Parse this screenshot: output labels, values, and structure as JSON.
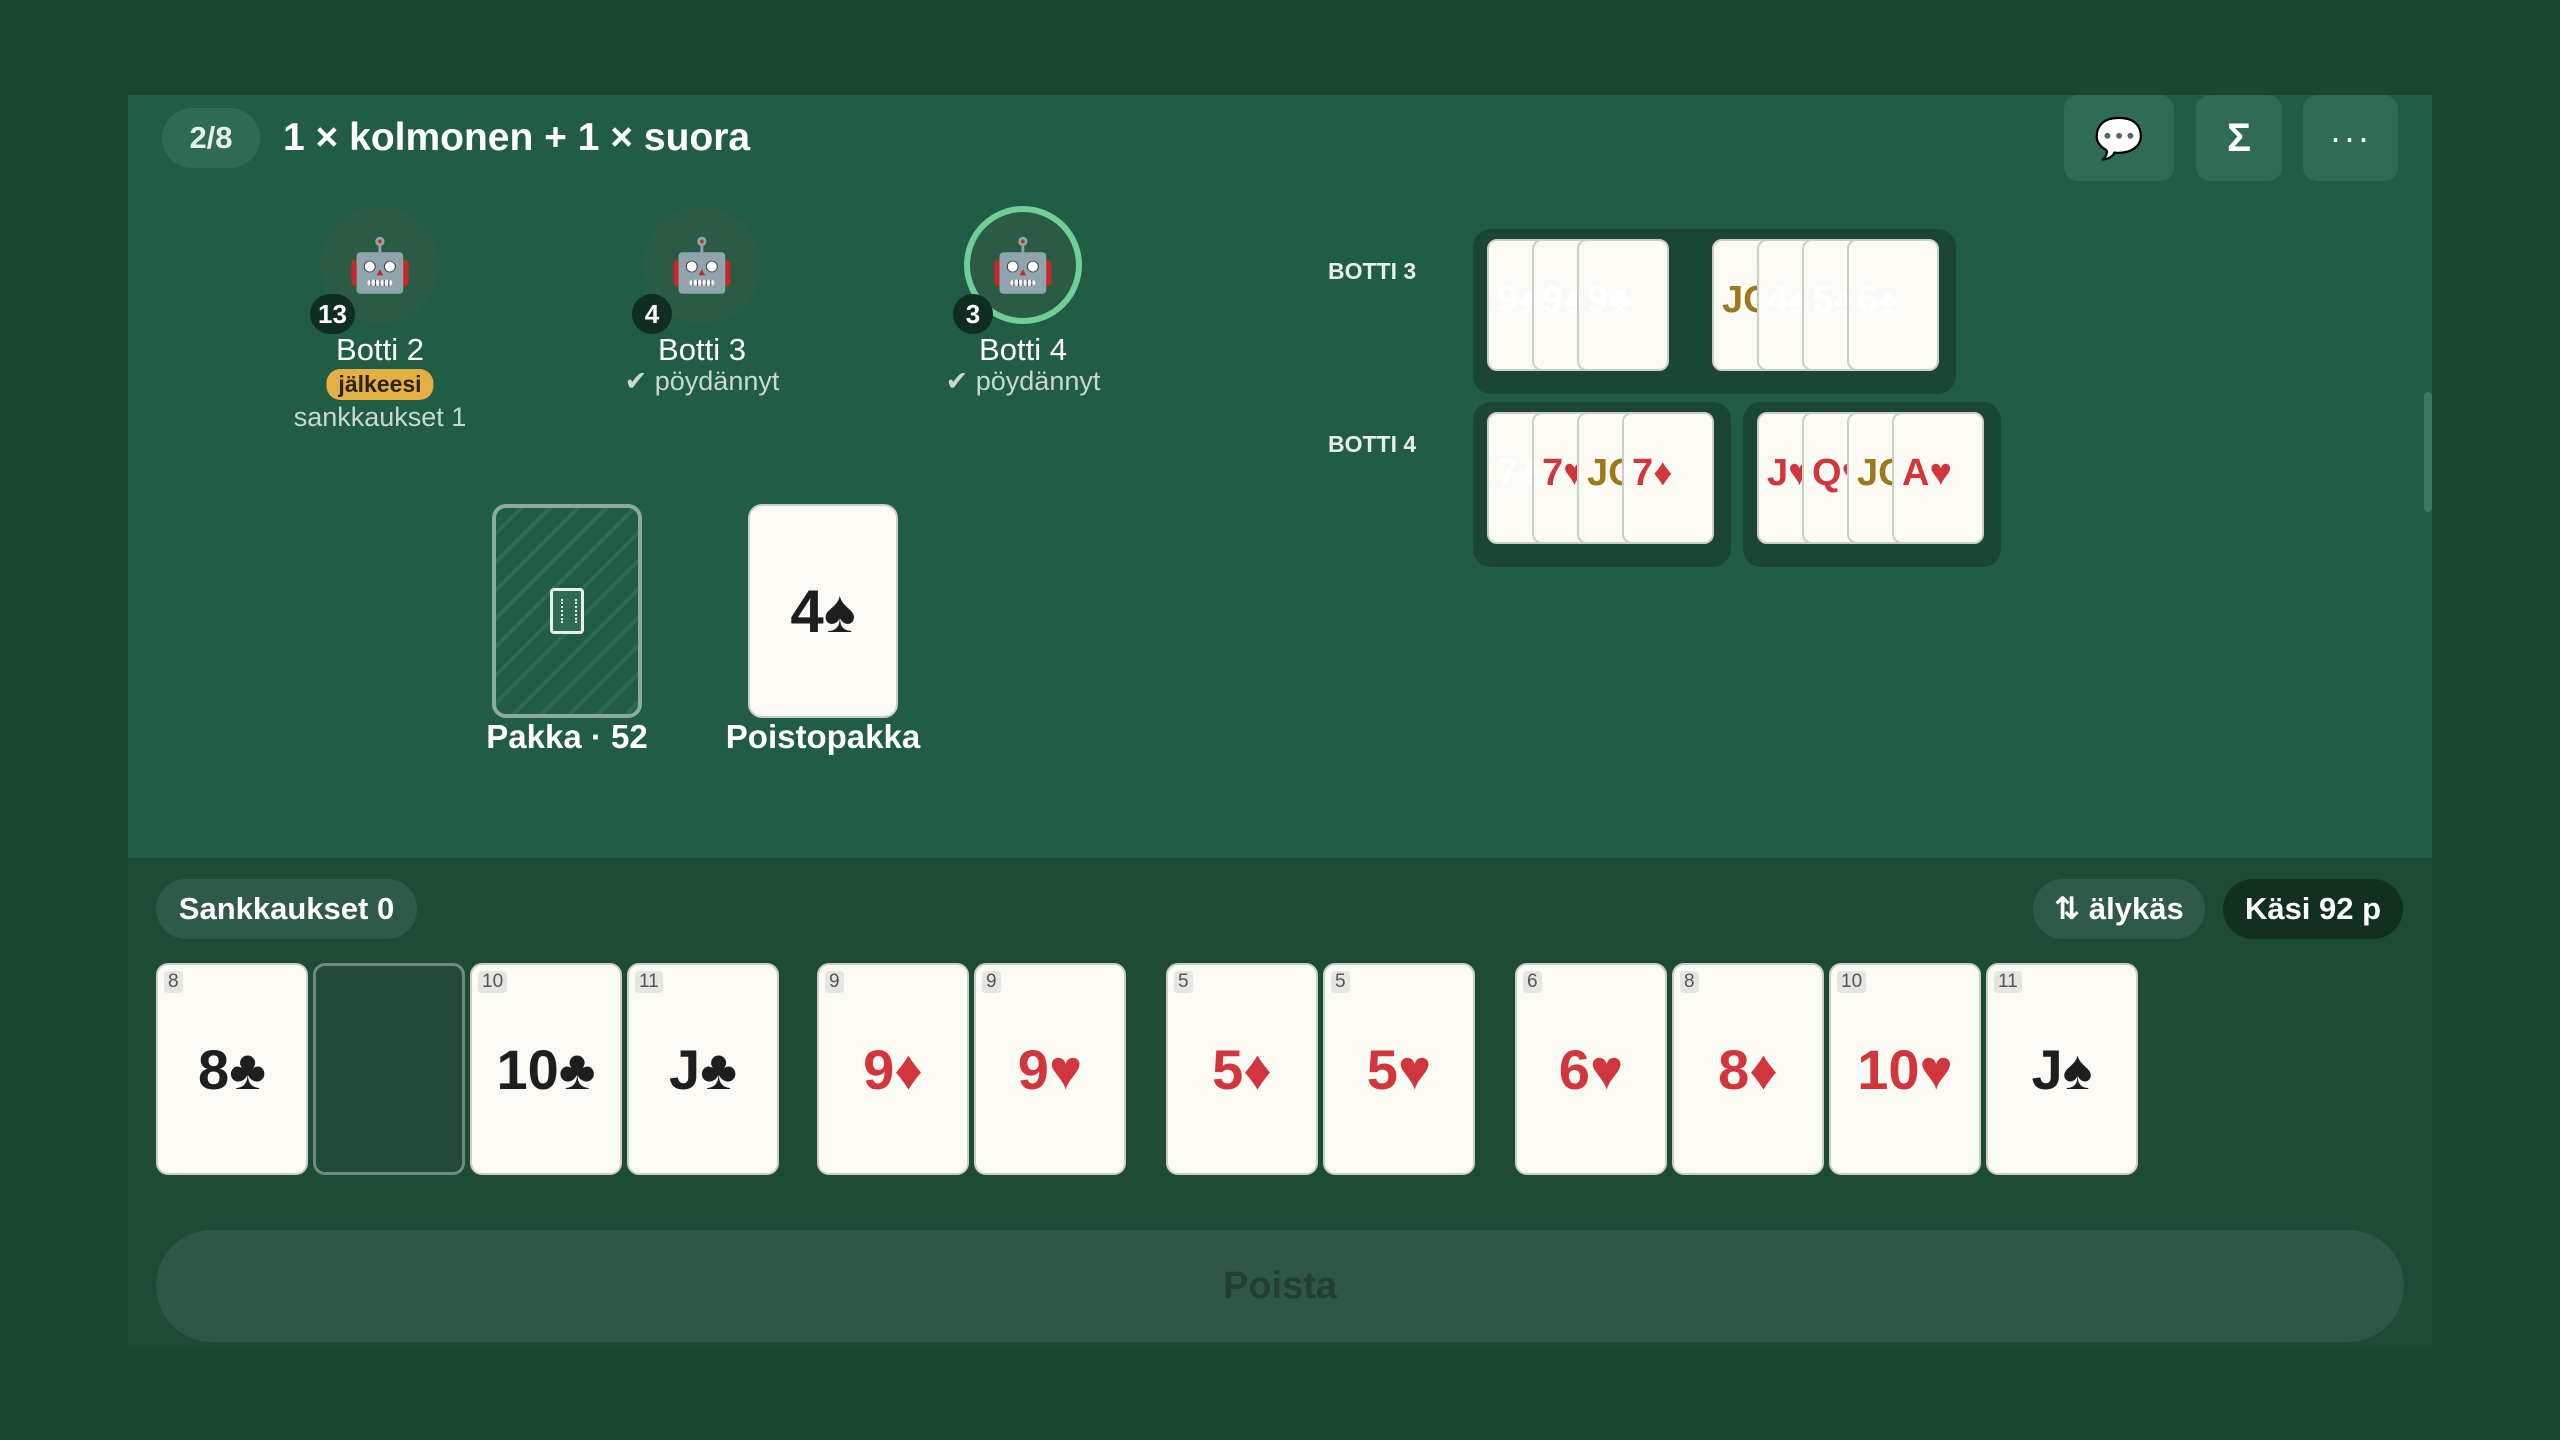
{
  "header": {
    "round": "2/8",
    "goal": "1 × kolmonen + 1 × suora",
    "buttons": {
      "chat_icon": "💬",
      "score_icon": "Σ",
      "more_icon": "···"
    }
  },
  "players": [
    {
      "name": "Botti 2",
      "count": "13",
      "tag": "jälkeesi",
      "status": "sankkaukset 1",
      "avatar": "🤖",
      "active": false
    },
    {
      "name": "Botti 3",
      "count": "4",
      "status": "✔ pöydännyt",
      "avatar": "🤖",
      "active": false
    },
    {
      "name": "Botti 4",
      "count": "3",
      "status": "✔ pöydännyt",
      "avatar": "🤖",
      "active": true
    }
  ],
  "melds": [
    {
      "label": "BOTTI 3",
      "groups": [
        [
          {
            "t": "9♠",
            "c": "black"
          },
          {
            "t": "9♠",
            "c": "black"
          },
          {
            "t": "9♣",
            "c": "black"
          }
        ],
        [
          {
            "t": "JOKERI",
            "c": "face"
          },
          {
            "t": "4♠",
            "c": "black"
          },
          {
            "t": "5♠",
            "c": "black"
          },
          {
            "t": "6♠",
            "c": "black"
          }
        ]
      ]
    },
    {
      "label": "BOTTI 4",
      "groups": [
        [
          {
            "t": "7♣",
            "c": "black"
          },
          {
            "t": "7♥",
            "c": "red"
          },
          {
            "t": "JOKERI",
            "c": "face"
          },
          {
            "t": "7♦",
            "c": "red"
          }
        ],
        [
          {
            "t": "J♥",
            "c": "red"
          },
          {
            "t": "Q♥",
            "c": "red"
          },
          {
            "t": "JOKERI",
            "c": "face"
          },
          {
            "t": "A♥",
            "c": "red"
          }
        ]
      ]
    }
  ],
  "piles": {
    "deck_label": "Pakka · 52",
    "discard_card": "4♠",
    "discard_label": "Poistopakka"
  },
  "hand_bar": {
    "sankkaukset": "Sankkaukset 0",
    "sort": "⇅ älykäs",
    "hand_points": "Käsi 92 p"
  },
  "hand": [
    {
      "corner": "8",
      "face": "8♣",
      "c": "black"
    },
    {
      "corner": "",
      "face": "",
      "c": "empty"
    },
    {
      "corner": "10",
      "face": "10♣",
      "c": "black"
    },
    {
      "corner": "11",
      "face": "J♣",
      "c": "black"
    },
    {
      "corner": "9",
      "face": "9♦",
      "c": "red"
    },
    {
      "corner": "9",
      "face": "9♥",
      "c": "red"
    },
    {
      "corner": "5",
      "face": "5♦",
      "c": "red"
    },
    {
      "corner": "5",
      "face": "5♥",
      "c": "red"
    },
    {
      "corner": "6",
      "face": "6♥",
      "c": "red"
    },
    {
      "corner": "8",
      "face": "8♦",
      "c": "red"
    },
    {
      "corner": "10",
      "face": "10♥",
      "c": "red"
    },
    {
      "corner": "11",
      "face": "J♠",
      "c": "black"
    }
  ],
  "action": {
    "poista": "Poista"
  }
}
